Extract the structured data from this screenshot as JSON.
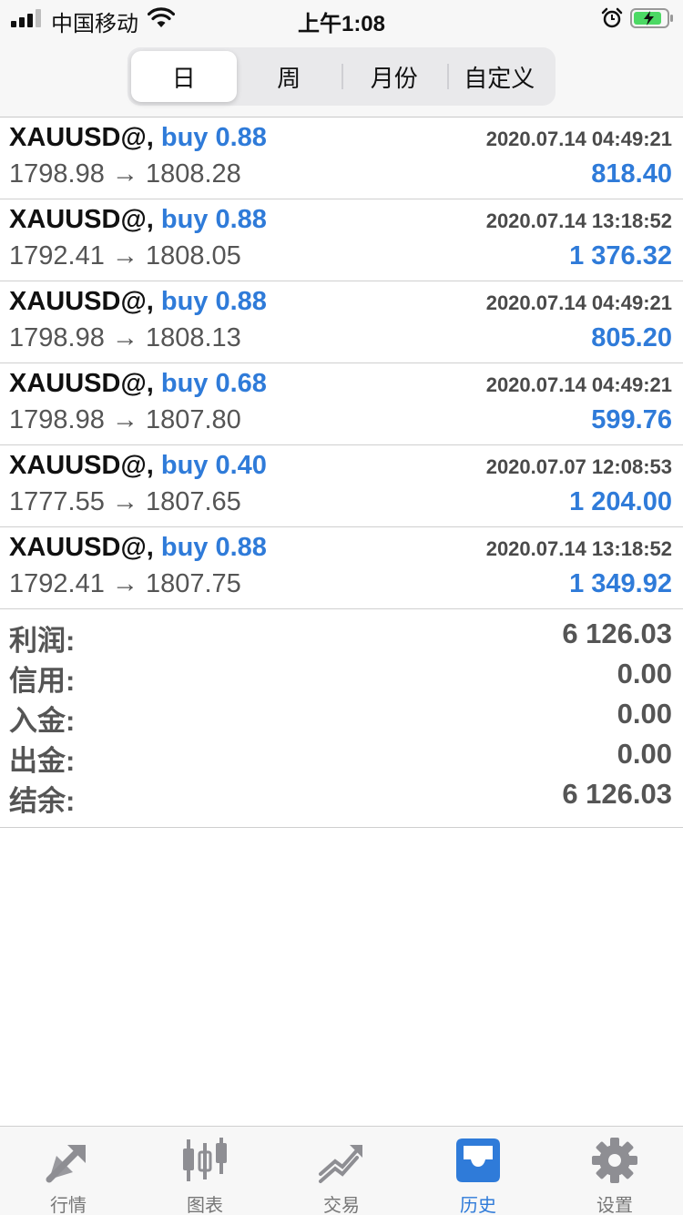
{
  "status_bar": {
    "carrier": "中国移动",
    "time": "上午1:08"
  },
  "period_tabs": {
    "items": [
      "日",
      "周",
      "月份",
      "自定义"
    ],
    "selected": "日"
  },
  "trades": [
    {
      "symbol": "XAUUSD@,",
      "type": "buy 0.88",
      "time": "2020.07.14 04:49:21",
      "prices": "1798.98 → 1808.28",
      "profit": "818.40"
    },
    {
      "symbol": "XAUUSD@,",
      "type": "buy 0.88",
      "time": "2020.07.14 13:18:52",
      "prices": "1792.41 → 1808.05",
      "profit": "1 376.32"
    },
    {
      "symbol": "XAUUSD@,",
      "type": "buy 0.88",
      "time": "2020.07.14 04:49:21",
      "prices": "1798.98 → 1808.13",
      "profit": "805.20"
    },
    {
      "symbol": "XAUUSD@,",
      "type": "buy 0.68",
      "time": "2020.07.14 04:49:21",
      "prices": "1798.98 → 1807.80",
      "profit": "599.76"
    },
    {
      "symbol": "XAUUSD@,",
      "type": "buy 0.40",
      "time": "2020.07.07 12:08:53",
      "prices": "1777.55 → 1807.65",
      "profit": "1 204.00"
    },
    {
      "symbol": "XAUUSD@,",
      "type": "buy 0.88",
      "time": "2020.07.14 13:18:52",
      "prices": "1792.41 → 1807.75",
      "profit": "1 349.92"
    }
  ],
  "summary": {
    "profit_label": "利润:",
    "profit_value": "6 126.03",
    "credit_label": "信用:",
    "credit_value": "0.00",
    "deposit_label": "入金:",
    "deposit_value": "0.00",
    "withdrawal_label": "出金:",
    "withdrawal_value": "0.00",
    "balance_label": "结余:",
    "balance_value": "6 126.03"
  },
  "tabbar": {
    "items": [
      {
        "label": "行情",
        "icon": "quotes-icon"
      },
      {
        "label": "图表",
        "icon": "chart-icon"
      },
      {
        "label": "交易",
        "icon": "trade-icon"
      },
      {
        "label": "历史",
        "icon": "history-icon"
      },
      {
        "label": "设置",
        "icon": "settings-icon"
      }
    ],
    "active": "历史"
  },
  "colors": {
    "accent": "#2f7bd9",
    "inactive_icon": "#8e8e93",
    "battery_green": "#4cd964"
  }
}
